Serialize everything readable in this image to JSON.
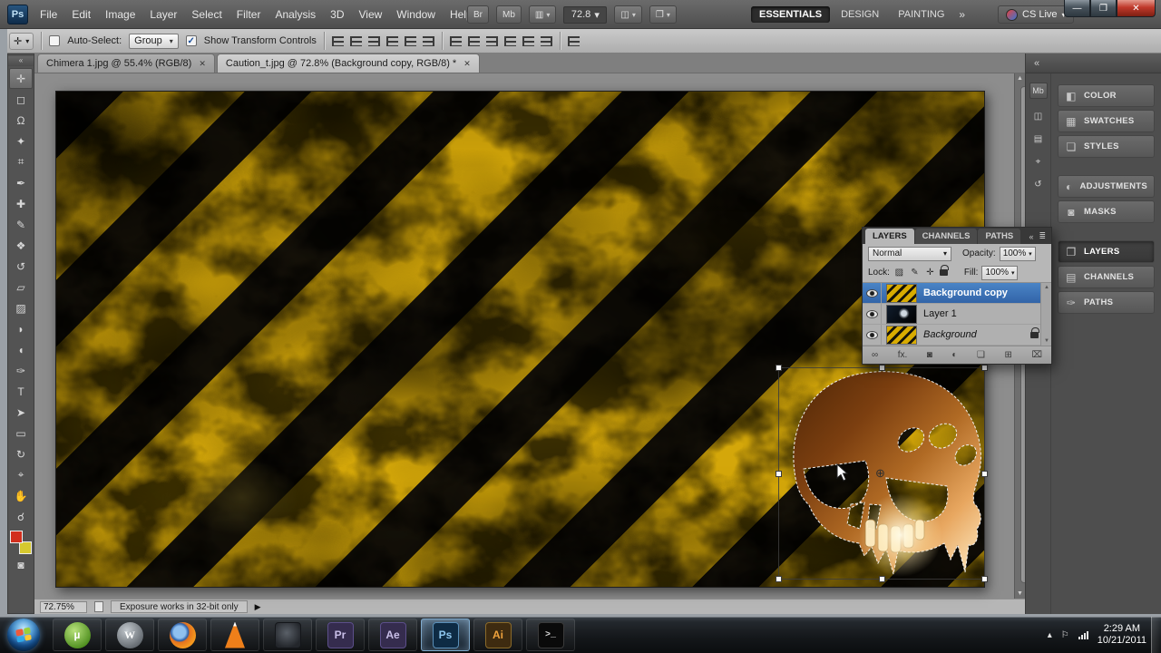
{
  "icons": {
    "dropdown": "▾",
    "check": "✓",
    "close": "✕",
    "collapse": "«",
    "panel_menu": "≣",
    "win_min": "—",
    "win_restore": "❐",
    "win_close": "✕",
    "play": "▶",
    "scroll_up": "▲",
    "scroll_down": "▼",
    "more": "»",
    "center": "⊕",
    "bridge": "Br",
    "mini_bridge": "Mb",
    "extras": "▥",
    "arrange": "◫",
    "screen_mode": "❐",
    "tool_preset": "✛",
    "link": "∞",
    "fx": "fx.",
    "mask": "◙",
    "adjust": "◐",
    "folder": "❏",
    "new_layer": "⊞",
    "trash": "⌧",
    "lock_transparent": "▨",
    "lock_pixels": "✎",
    "lock_position": "✛",
    "dock_color": "◧",
    "dock_swatches": "▦",
    "dock_styles": "❏",
    "dock_adjustments": "◐",
    "dock_masks": "◙",
    "dock_layers": "❐",
    "dock_channels": "▤",
    "dock_paths": "✑",
    "strip_1": "Mb",
    "strip_2": "◫",
    "strip_3": "▤",
    "strip_4": "⌖",
    "strip_5": "↺",
    "tray_up": "▴",
    "tray_flag": "⚐"
  },
  "titlebar": {
    "logo": "Ps",
    "menus": [
      "File",
      "Edit",
      "Image",
      "Layer",
      "Select",
      "Filter",
      "Analysis",
      "3D",
      "View",
      "Window",
      "Help"
    ],
    "zoom": "72.8",
    "workspaces": [
      "ESSENTIALS",
      "DESIGN",
      "PAINTING"
    ],
    "cslive": "CS Live"
  },
  "options": {
    "autoselect_label": "Auto-Select:",
    "autoselect_value": "Group",
    "transform_label": "Show Transform Controls"
  },
  "doc_tabs": [
    {
      "label": "Chimera 1.jpg @ 55.4% (RGB/8)"
    },
    {
      "label": "Caution_t.jpg @ 72.8% (Background copy, RGB/8) *"
    }
  ],
  "tools": [
    {
      "name": "move",
      "glyph": "✛"
    },
    {
      "name": "rectangular-marquee",
      "glyph": "◻"
    },
    {
      "name": "lasso",
      "glyph": "Ω"
    },
    {
      "name": "quick-selection",
      "glyph": "✦"
    },
    {
      "name": "crop",
      "glyph": "⌗"
    },
    {
      "name": "eyedropper",
      "glyph": "✒"
    },
    {
      "name": "spot-healing-brush",
      "glyph": "✚"
    },
    {
      "name": "brush",
      "glyph": "✎"
    },
    {
      "name": "clone-stamp",
      "glyph": "❖"
    },
    {
      "name": "history-brush",
      "glyph": "↺"
    },
    {
      "name": "eraser",
      "glyph": "▱"
    },
    {
      "name": "gradient",
      "glyph": "▨"
    },
    {
      "name": "blur",
      "glyph": "◗"
    },
    {
      "name": "dodge",
      "glyph": "◖"
    },
    {
      "name": "pen",
      "glyph": "✑"
    },
    {
      "name": "type",
      "glyph": "T"
    },
    {
      "name": "path-selection",
      "glyph": "➤"
    },
    {
      "name": "rectangle-shape",
      "glyph": "▭"
    },
    {
      "name": "3d-object-rotate",
      "glyph": "↻"
    },
    {
      "name": "3d-camera-rotate",
      "glyph": "⌖"
    },
    {
      "name": "hand",
      "glyph": "✋"
    },
    {
      "name": "zoom",
      "glyph": "☌"
    }
  ],
  "tool_colors": {
    "foreground": "#d22f1e",
    "background": "#d6c92f"
  },
  "dock": {
    "buttons": [
      "COLOR",
      "SWATCHES",
      "STYLES",
      "ADJUSTMENTS",
      "MASKS",
      "LAYERS",
      "CHANNELS",
      "PATHS"
    ]
  },
  "layers_panel": {
    "tabs": [
      "LAYERS",
      "CHANNELS",
      "PATHS"
    ],
    "blend_mode": "Normal",
    "opacity_label": "Opacity:",
    "opacity_value": "100%",
    "lock_label": "Lock:",
    "fill_label": "Fill:",
    "fill_value": "100%",
    "layers": [
      {
        "name": "Background copy"
      },
      {
        "name": "Layer 1"
      },
      {
        "name": "Background"
      }
    ]
  },
  "statusbar": {
    "zoom": "72.75%",
    "message": "Exposure works in 32-bit only"
  },
  "taskbar": {
    "apps": [
      {
        "name": "utorrent",
        "glyph": "µ"
      },
      {
        "name": "wordpress",
        "glyph": "W"
      },
      {
        "name": "firefox",
        "glyph": ""
      },
      {
        "name": "media-player",
        "glyph": ""
      },
      {
        "name": "movie-app",
        "glyph": ""
      },
      {
        "name": "premiere",
        "glyph": "Pr"
      },
      {
        "name": "after-effects",
        "glyph": "Ae"
      },
      {
        "name": "photoshop",
        "glyph": "Ps"
      },
      {
        "name": "illustrator",
        "glyph": "Ai"
      },
      {
        "name": "command-prompt",
        "glyph": ">_"
      }
    ],
    "time": "2:29 AM",
    "date": "10/21/2011"
  }
}
